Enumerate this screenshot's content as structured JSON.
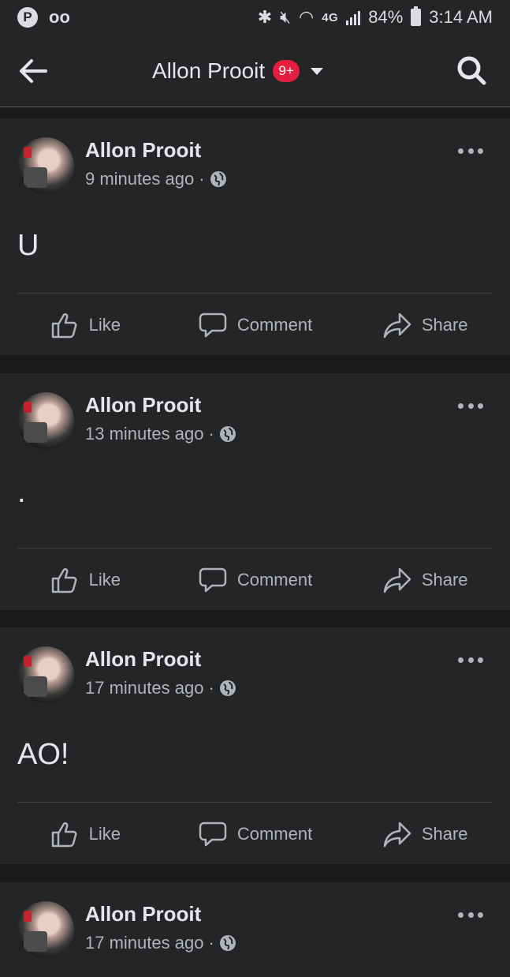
{
  "status_bar": {
    "voicemail": "oo",
    "network": "4G",
    "battery": "84%",
    "time": "3:14 AM"
  },
  "header": {
    "title": "Allon Prooit",
    "badge": "9+"
  },
  "actions": {
    "like": "Like",
    "comment": "Comment",
    "share": "Share"
  },
  "posts": [
    {
      "author": "Allon Prooit",
      "time": "9 minutes ago ·",
      "text": "U"
    },
    {
      "author": "Allon Prooit",
      "time": "13 minutes ago ·",
      "text": "."
    },
    {
      "author": "Allon Prooit",
      "time": "17 minutes ago ·",
      "text": "AO!"
    },
    {
      "author": "Allon Prooit",
      "time": "17 minutes ago ·",
      "text": ""
    }
  ],
  "colors": {
    "background": "#18191a",
    "surface": "#242526",
    "badge": "#e41e3f",
    "text_primary": "#e4e6eb",
    "text_secondary": "#b0b3b8"
  }
}
